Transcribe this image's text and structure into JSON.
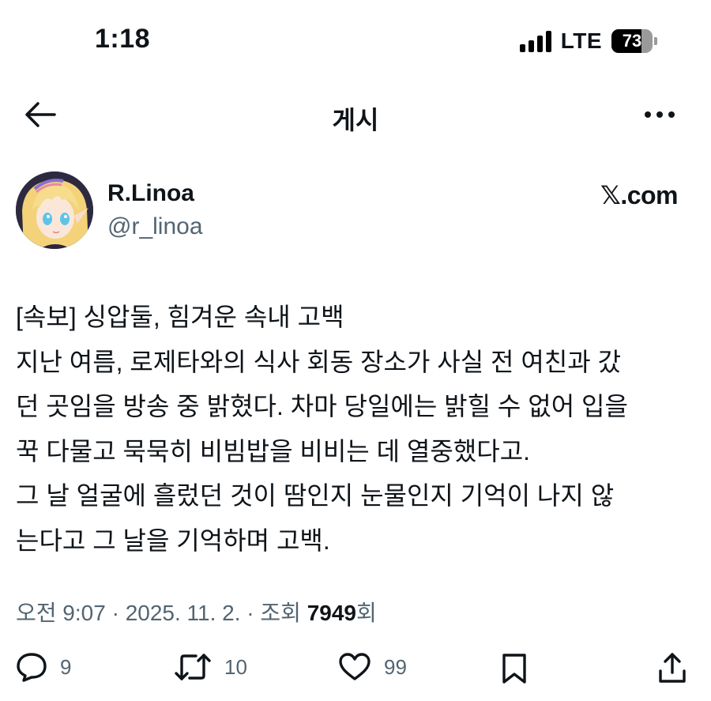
{
  "status_bar": {
    "time": "1:18",
    "network": "LTE",
    "battery": "73",
    "battery_level": 0.73
  },
  "header": {
    "title": "게시",
    "back_icon": "back-arrow-icon",
    "more_icon": "more-dots-icon"
  },
  "author": {
    "name": "R.Linoa",
    "handle": "@r_linoa",
    "source": "𝕏.com"
  },
  "post": {
    "lines": [
      "[속보] 싱압둘, 힘겨운 속내 고백",
      "지난 여름, 로제타와의 식사 회동 장소가 사실 전 여친과 갔",
      "던 곳임을 방송 중 밝혔다. 차마 당일에는 밝힐 수 없어 입을",
      "꾹 다물고 묵묵히 비빔밥을 비비는 데 열중했다고.",
      "그 날 얼굴에 흘렀던 것이 땀인지 눈물인지 기억이 나지 않",
      "는다고 그 날을 기억하며 고백."
    ]
  },
  "meta": {
    "time": "오전 9:07",
    "date": "2025. 11. 2.",
    "separator": " · ",
    "views_label": "조회 ",
    "views_count": "7949",
    "views_suffix": "회"
  },
  "actions": {
    "replies": "9",
    "reposts": "10",
    "likes": "99"
  },
  "colors": {
    "text": "#0f1419",
    "secondary": "#536471",
    "background": "#ffffff"
  }
}
